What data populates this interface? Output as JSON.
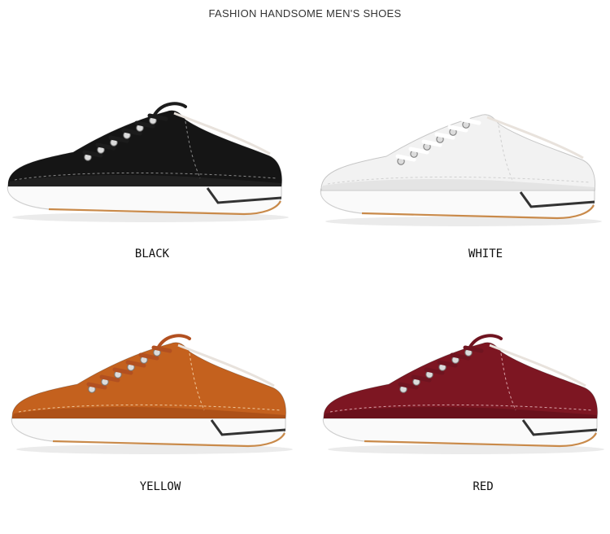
{
  "header": {
    "title": "FASHION HANDSOME MEN'S SHOES"
  },
  "products": [
    {
      "label": "BLACK",
      "upper": "#151515",
      "shade": "#2a2a2a",
      "lace": "#1c1c1c",
      "stitch": "#8a8a8a"
    },
    {
      "label": "WHITE",
      "upper": "#f2f2f2",
      "shade": "#d9d9d9",
      "lace": "#ffffff",
      "stitch": "#cfcfcf"
    },
    {
      "label": "YELLOW",
      "upper": "#c4611e",
      "shade": "#9b4514",
      "lace": "#b25020",
      "stitch": "#f0c89c"
    },
    {
      "label": "RED",
      "upper": "#7d1622",
      "shade": "#5a0e18",
      "lace": "#6f1420",
      "stitch": "#d8a4aa"
    }
  ]
}
